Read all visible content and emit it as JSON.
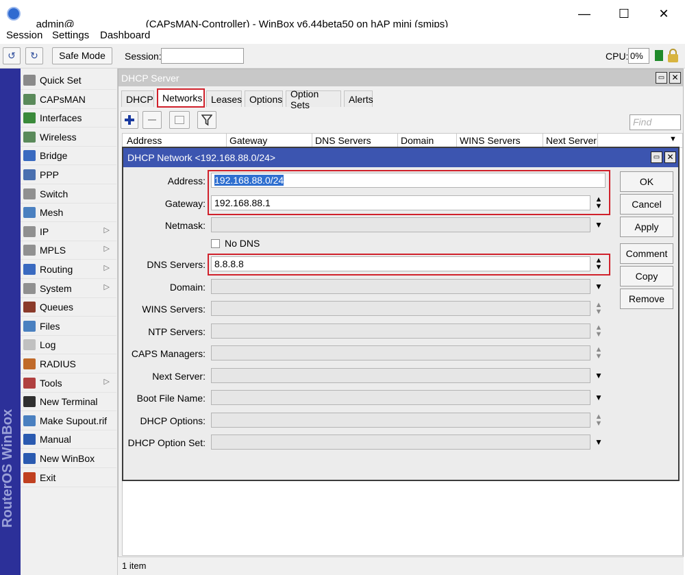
{
  "window": {
    "title_left": "admin@",
    "title_right": "(CAPsMAN-Controller) - WinBox v6.44beta50 on hAP mini (smips)",
    "controls": {
      "minimize": "—",
      "maximize": "☐",
      "close": "✕"
    }
  },
  "menu": {
    "session": "Session",
    "settings": "Settings",
    "dashboard": "Dashboard"
  },
  "toolbar": {
    "safe_mode": "Safe Mode",
    "session_label": "Session:",
    "session_value": "",
    "cpu_label": "CPU:",
    "cpu_value": "0%"
  },
  "brand": "RouterOS WinBox",
  "sidebar": {
    "items": [
      {
        "label": "Quick Set",
        "icon": "quick-set-icon",
        "color": "#8a8a8a",
        "sub": false
      },
      {
        "label": "CAPsMAN",
        "icon": "antenna-icon",
        "color": "#5a8a5a",
        "sub": false
      },
      {
        "label": "Interfaces",
        "icon": "interfaces-icon",
        "color": "#3a8a3a",
        "sub": false
      },
      {
        "label": "Wireless",
        "icon": "wireless-icon",
        "color": "#5a8a5a",
        "sub": false
      },
      {
        "label": "Bridge",
        "icon": "bridge-icon",
        "color": "#3a6ac0",
        "sub": false
      },
      {
        "label": "PPP",
        "icon": "ppp-icon",
        "color": "#4a70b0",
        "sub": false
      },
      {
        "label": "Switch",
        "icon": "switch-icon",
        "color": "#909090",
        "sub": false
      },
      {
        "label": "Mesh",
        "icon": "mesh-icon",
        "color": "#4a80c0",
        "sub": false
      },
      {
        "label": "IP",
        "icon": "ip-icon",
        "color": "#909090",
        "sub": true
      },
      {
        "label": "MPLS",
        "icon": "mpls-icon",
        "color": "#909090",
        "sub": true
      },
      {
        "label": "Routing",
        "icon": "routing-icon",
        "color": "#3a6ac0",
        "sub": true
      },
      {
        "label": "System",
        "icon": "system-icon",
        "color": "#909090",
        "sub": true
      },
      {
        "label": "Queues",
        "icon": "queues-icon",
        "color": "#8a3a2a",
        "sub": false
      },
      {
        "label": "Files",
        "icon": "files-icon",
        "color": "#4a80c0",
        "sub": false
      },
      {
        "label": "Log",
        "icon": "log-icon",
        "color": "#c0c0c0",
        "sub": false
      },
      {
        "label": "RADIUS",
        "icon": "radius-icon",
        "color": "#c06a2a",
        "sub": false
      },
      {
        "label": "Tools",
        "icon": "tools-icon",
        "color": "#b04040",
        "sub": true
      },
      {
        "label": "New Terminal",
        "icon": "terminal-icon",
        "color": "#303030",
        "sub": false
      },
      {
        "label": "Make Supout.rif",
        "icon": "supout-icon",
        "color": "#4a80c0",
        "sub": false
      },
      {
        "label": "Manual",
        "icon": "manual-icon",
        "color": "#2a5ab0",
        "sub": false
      },
      {
        "label": "New WinBox",
        "icon": "winbox-icon",
        "color": "#2a5ab0",
        "sub": false
      },
      {
        "label": "Exit",
        "icon": "exit-icon",
        "color": "#c04020",
        "sub": false
      }
    ]
  },
  "dhcp_server": {
    "title": "DHCP Server",
    "tabs": [
      "DHCP",
      "Networks",
      "Leases",
      "Options",
      "Option Sets",
      "Alerts"
    ],
    "active_tab": "Networks",
    "find_placeholder": "Find",
    "columns": [
      "Address",
      "Gateway",
      "DNS Servers",
      "Domain",
      "WINS Servers",
      "Next Server"
    ],
    "status": "1 item"
  },
  "dialog": {
    "title": "DHCP Network <192.168.88.0/24>",
    "fields": {
      "address": {
        "label": "Address:",
        "value": "192.168.88.0/24"
      },
      "gateway": {
        "label": "Gateway:",
        "value": "192.168.88.1"
      },
      "netmask": {
        "label": "Netmask:",
        "value": ""
      },
      "no_dns": {
        "label": "No DNS",
        "checked": false
      },
      "dns_servers": {
        "label": "DNS Servers:",
        "value": "8.8.8.8"
      },
      "domain": {
        "label": "Domain:",
        "value": ""
      },
      "wins_servers": {
        "label": "WINS Servers:",
        "value": ""
      },
      "ntp_servers": {
        "label": "NTP Servers:",
        "value": ""
      },
      "caps_managers": {
        "label": "CAPS Managers:",
        "value": ""
      },
      "next_server": {
        "label": "Next Server:",
        "value": ""
      },
      "boot_file_name": {
        "label": "Boot File Name:",
        "value": ""
      },
      "dhcp_options": {
        "label": "DHCP Options:",
        "value": ""
      },
      "dhcp_option_set": {
        "label": "DHCP Option Set:",
        "value": ""
      }
    },
    "buttons": {
      "ok": "OK",
      "cancel": "Cancel",
      "apply": "Apply",
      "comment": "Comment",
      "copy": "Copy",
      "remove": "Remove"
    }
  },
  "colors": {
    "accent": "#3c55b0",
    "highlight": "#d0202a",
    "brand": "#2c3099"
  }
}
